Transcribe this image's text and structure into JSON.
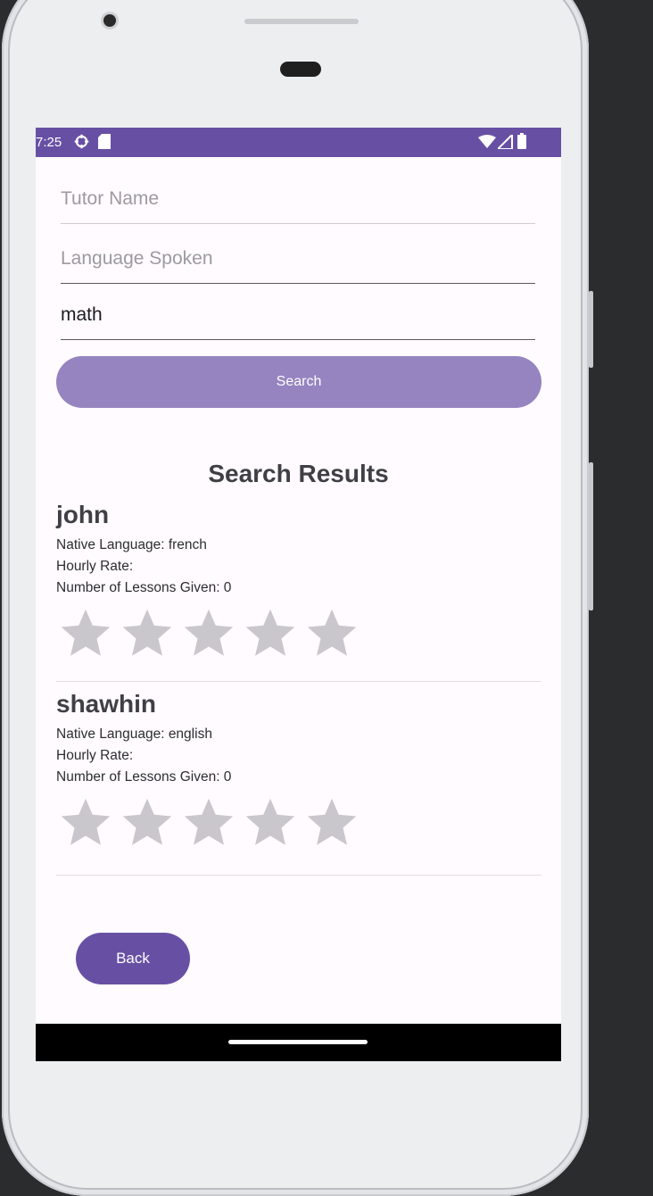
{
  "status_bar": {
    "time": "7:25",
    "icons": [
      "gear-icon",
      "sd-card-icon",
      "wifi-icon",
      "signal-icon",
      "battery-icon"
    ]
  },
  "form": {
    "tutor_name": {
      "value": "",
      "placeholder": "Tutor Name"
    },
    "language_spoken": {
      "value": "",
      "placeholder": "Language Spoken"
    },
    "subject": {
      "value": "math",
      "placeholder": ""
    },
    "search_label": "Search"
  },
  "results": {
    "title": "Search Results",
    "items": [
      {
        "name": "john",
        "native_language": "Native Language: french",
        "hourly_rate": "Hourly Rate:",
        "lessons": "Number of Lessons Given: 0",
        "rating": 0,
        "max_rating": 5
      },
      {
        "name": "shawhin",
        "native_language": "Native Language: english",
        "hourly_rate": "Hourly Rate:",
        "lessons": "Number of Lessons Given: 0",
        "rating": 0,
        "max_rating": 5
      }
    ]
  },
  "back_label": "Back",
  "colors": {
    "accent": "#6750a4",
    "search_button": "#9584bf",
    "star_empty": "#cac7cc",
    "background": "#fffbfe"
  }
}
